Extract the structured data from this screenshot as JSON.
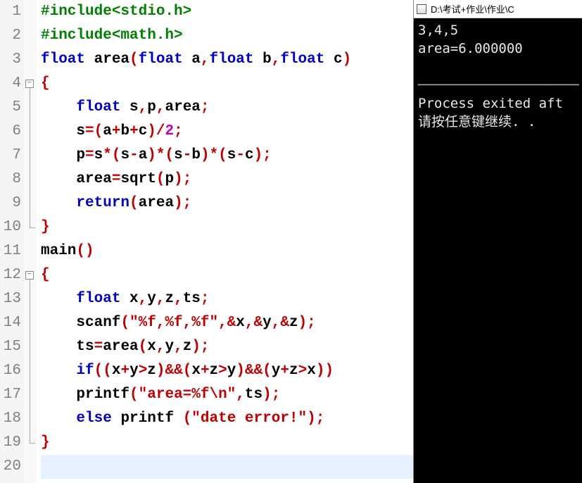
{
  "editor": {
    "lines": [
      {
        "n": "1",
        "fold": null,
        "html": "<span class='inc'>#include&lt;stdio.h&gt;</span>"
      },
      {
        "n": "2",
        "fold": null,
        "html": "<span class='inc'>#include&lt;math.h&gt;</span>"
      },
      {
        "n": "3",
        "fold": null,
        "html": "<span class='kw'>float</span> <span class='plain'>area</span><span class='br'>(</span><span class='kw'>float</span> <span class='plain'>a</span><span class='op'>,</span><span class='kw'>float</span> <span class='plain'>b</span><span class='op'>,</span><span class='kw'>float</span> <span class='plain'>c</span><span class='br'>)</span>"
      },
      {
        "n": "4",
        "fold": "open",
        "html": "<span class='br'>{</span>"
      },
      {
        "n": "5",
        "fold": "mid",
        "html": "    <span class='kw'>float</span> <span class='plain'>s</span><span class='op'>,</span><span class='plain'>p</span><span class='op'>,</span><span class='plain'>area</span><span class='op'>;</span>"
      },
      {
        "n": "6",
        "fold": "mid",
        "html": "    <span class='plain'>s</span><span class='op'>=(</span><span class='plain'>a</span><span class='op'>+</span><span class='plain'>b</span><span class='op'>+</span><span class='plain'>c</span><span class='op'>)/</span><span class='num'>2</span><span class='op'>;</span>"
      },
      {
        "n": "7",
        "fold": "mid",
        "html": "    <span class='plain'>p</span><span class='op'>=</span><span class='plain'>s</span><span class='op'>*(</span><span class='plain'>s</span><span class='op'>-</span><span class='plain'>a</span><span class='op'>)*(</span><span class='plain'>s</span><span class='op'>-</span><span class='plain'>b</span><span class='op'>)*(</span><span class='plain'>s</span><span class='op'>-</span><span class='plain'>c</span><span class='op'>);</span>"
      },
      {
        "n": "8",
        "fold": "mid",
        "html": "    <span class='plain'>area</span><span class='op'>=</span><span class='plain'>sqrt</span><span class='op'>(</span><span class='plain'>p</span><span class='op'>);</span>"
      },
      {
        "n": "9",
        "fold": "mid",
        "html": "    <span class='kw'>return</span><span class='op'>(</span><span class='plain'>area</span><span class='op'>);</span>"
      },
      {
        "n": "10",
        "fold": "end",
        "html": "<span class='br'>}</span>"
      },
      {
        "n": "11",
        "fold": null,
        "html": "<span class='plain'>main</span><span class='op'>()</span>"
      },
      {
        "n": "12",
        "fold": "open",
        "html": "<span class='br'>{</span>"
      },
      {
        "n": "13",
        "fold": "mid",
        "html": "    <span class='kw'>float</span> <span class='plain'>x</span><span class='op'>,</span><span class='plain'>y</span><span class='op'>,</span><span class='plain'>z</span><span class='op'>,</span><span class='plain'>ts</span><span class='op'>;</span>"
      },
      {
        "n": "14",
        "fold": "mid",
        "html": "    <span class='plain'>scanf</span><span class='op'>(</span><span class='str'>\"%f,%f,%f\"</span><span class='op'>,&amp;</span><span class='plain'>x</span><span class='op'>,&amp;</span><span class='plain'>y</span><span class='op'>,&amp;</span><span class='plain'>z</span><span class='op'>);</span>"
      },
      {
        "n": "15",
        "fold": "mid",
        "html": "    <span class='plain'>ts</span><span class='op'>=</span><span class='plain'>area</span><span class='op'>(</span><span class='plain'>x</span><span class='op'>,</span><span class='plain'>y</span><span class='op'>,</span><span class='plain'>z</span><span class='op'>);</span>"
      },
      {
        "n": "16",
        "fold": "mid",
        "html": "    <span class='kw'>if</span><span class='op'>((</span><span class='plain'>x</span><span class='op'>+</span><span class='plain'>y</span><span class='op'>&gt;</span><span class='plain'>z</span><span class='op'>)&amp;&amp;(</span><span class='plain'>x</span><span class='op'>+</span><span class='plain'>z</span><span class='op'>&gt;</span><span class='plain'>y</span><span class='op'>)&amp;&amp;(</span><span class='plain'>y</span><span class='op'>+</span><span class='plain'>z</span><span class='op'>&gt;</span><span class='plain'>x</span><span class='op'>))</span>"
      },
      {
        "n": "17",
        "fold": "mid",
        "html": "    <span class='plain'>printf</span><span class='op'>(</span><span class='str'>\"area=%f\\n\"</span><span class='op'>,</span><span class='plain'>ts</span><span class='op'>);</span>"
      },
      {
        "n": "18",
        "fold": "mid",
        "html": "    <span class='kw'>else</span> <span class='plain'>printf</span> <span class='op'>(</span><span class='str'>\"date error!\"</span><span class='op'>);</span>"
      },
      {
        "n": "19",
        "fold": "end",
        "html": "<span class='br'>}</span>"
      },
      {
        "n": "20",
        "fold": null,
        "html": "",
        "current": true
      }
    ]
  },
  "console": {
    "title": "D:\\考试+作业\\作业\\C",
    "lines": [
      "3,4,5",
      "area=6.000000",
      "",
      "--------------------",
      "Process exited aft",
      "请按任意键继续. ."
    ]
  }
}
